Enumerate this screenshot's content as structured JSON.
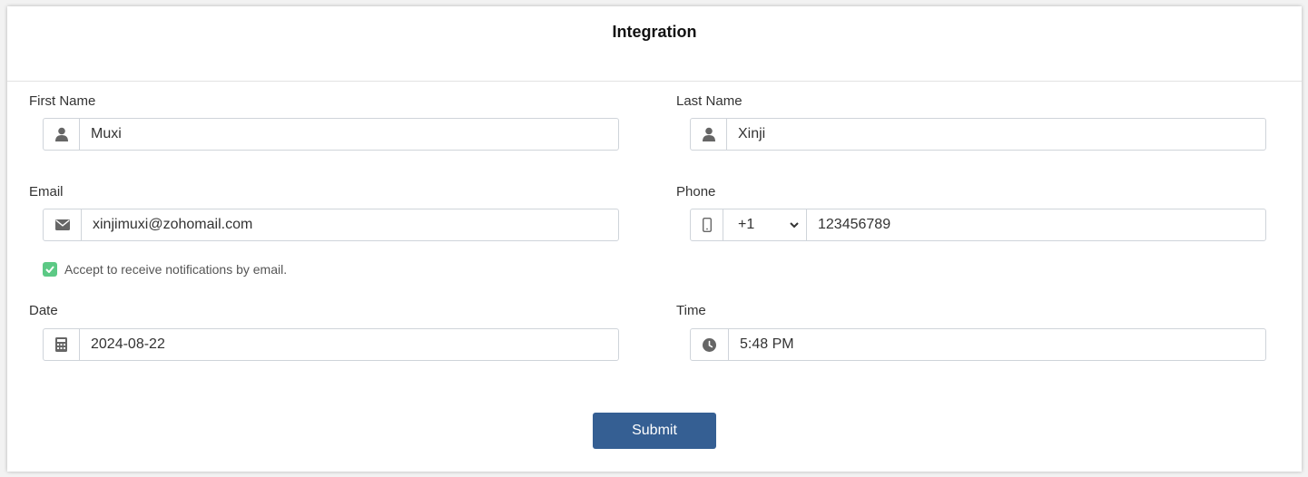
{
  "form": {
    "title": "Integration",
    "first_name": {
      "label": "First Name",
      "value": "Muxi",
      "icon": "user-icon"
    },
    "last_name": {
      "label": "Last Name",
      "value": "Xinji",
      "icon": "user-icon"
    },
    "email": {
      "label": "Email",
      "value": "xinjimuxi@zohomail.com",
      "icon": "envelope-icon"
    },
    "phone": {
      "label": "Phone",
      "country_code": "+1",
      "value": "123456789",
      "icon": "mobile-icon"
    },
    "notifications": {
      "label": "Accept to receive notifications by email.",
      "checked": true
    },
    "date": {
      "label": "Date",
      "value": "2024-08-22",
      "icon": "calculator-icon"
    },
    "time": {
      "label": "Time",
      "value": "5:48 PM",
      "icon": "clock-icon"
    },
    "submit_label": "Submit"
  },
  "colors": {
    "submit": "#355f93",
    "checkbox": "#5cc985",
    "border": "#cfd4da"
  }
}
